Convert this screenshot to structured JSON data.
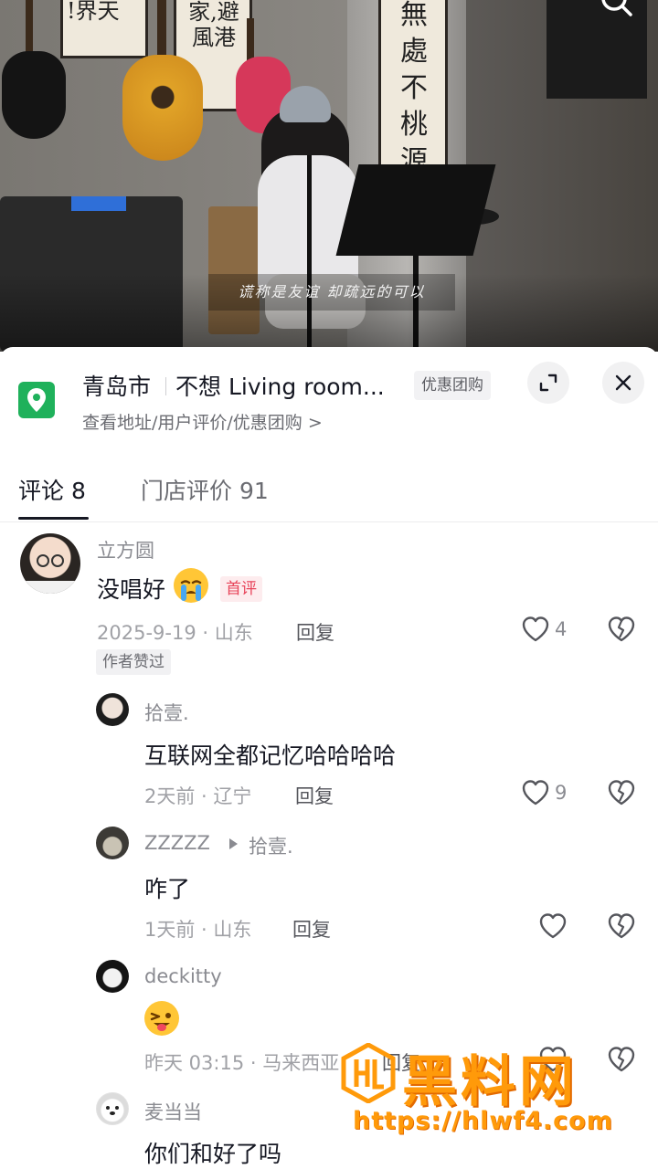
{
  "video": {
    "subtitle": "谎称是友谊 却疏远的可以",
    "scroll_left_text": "!界天",
    "scroll_mid_text": "家,避風港",
    "scroll_right_text": "無處不桃源"
  },
  "poi": {
    "city": "青岛市",
    "name": "不想 Living room...",
    "tag": "优惠团购",
    "sub_links": "查看地址/用户评价/优惠团购 >",
    "icon": "location-pin-icon"
  },
  "tabs": [
    {
      "label": "评论 8",
      "active": true
    },
    {
      "label": "门店评价 91",
      "active": false
    }
  ],
  "comments": [
    {
      "user": "立方圆",
      "text": "没唱好",
      "emoji": "crying-face",
      "badge": "首评",
      "meta": "2025-9-19 · 山东",
      "reply_label": "回复",
      "likes": "4",
      "author_badge": "作者赞过",
      "replies": [
        {
          "user": "拾壹.",
          "text": "互联网全都记忆哈哈哈哈",
          "meta": "2天前 · 辽宁",
          "reply_label": "回复",
          "likes": "9"
        },
        {
          "user": "ZZZZZ",
          "reply_to": "拾壹.",
          "text": "咋了",
          "meta": "1天前 · 山东",
          "reply_label": "回复",
          "likes": ""
        },
        {
          "user": "deckitty",
          "text": "",
          "emoji": "winking-tongue-face",
          "meta": "昨天 03:15 · 马来西亚",
          "reply_label": "回复",
          "likes": ""
        },
        {
          "user": "麦当当",
          "text": "你们和好了吗"
        }
      ]
    }
  ],
  "watermark": {
    "title": "黑料网",
    "url": "https://hlwf4.com"
  },
  "colors": {
    "poi_icon": "#1fb15b",
    "first_badge": "#e8445a",
    "watermark": "#ff9a0a"
  }
}
